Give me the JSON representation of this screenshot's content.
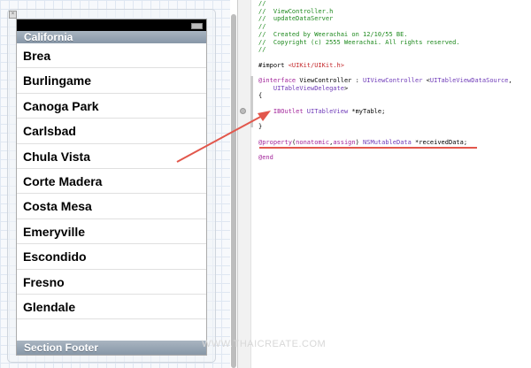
{
  "simulator": {
    "section_header": "California",
    "rows": [
      "Brea",
      "Burlingame",
      "Canoga Park",
      "Carlsbad",
      "Chula Vista",
      "Corte Madera",
      "Costa Mesa",
      "Emeryville",
      "Escondido",
      "Fresno",
      "Glendale"
    ],
    "section_footer": "Section Footer",
    "close_glyph": "×"
  },
  "code": {
    "l0": "//",
    "l1": "//  ViewController.h",
    "l2": "//  updateDataServer",
    "l3": "//",
    "l4": "//  Created by Weerachai on 12/10/55 BE.",
    "l5": "//  Copyright (c) 2555 Weerachai. All rights reserved.",
    "l6": "//",
    "import_kw": "#import ",
    "import_path": "<UIKit/UIKit.h>",
    "interface_kw": "@interface",
    "interface_name": " ViewController : ",
    "superclass": "UIViewController",
    "proto_open": " <",
    "proto1": "UITableViewDataSource",
    "proto_sep": ",",
    "proto2": "UITableViewDelegate",
    "proto_close": ">",
    "brace_open": "{",
    "iboutlet": "IBOutlet",
    "tableview_type": "UITableView",
    "ivar": " *myTable;",
    "brace_close": "}",
    "property_kw": "@property",
    "paren_open": "(",
    "attr1": "nonatomic",
    "comma": ",",
    "attr2": "assign",
    "paren_close": ")",
    "prop_type": "NSMutableData",
    "prop_name": " *receivedData;",
    "end_kw": "@end"
  },
  "watermark": "WWW.THAICREATE.COM",
  "colors": {
    "comment": "#1f8a1f",
    "keyword": "#a3269b",
    "type": "#6e3ab8",
    "string": "#c4282b",
    "annotation": "#e2574c"
  }
}
